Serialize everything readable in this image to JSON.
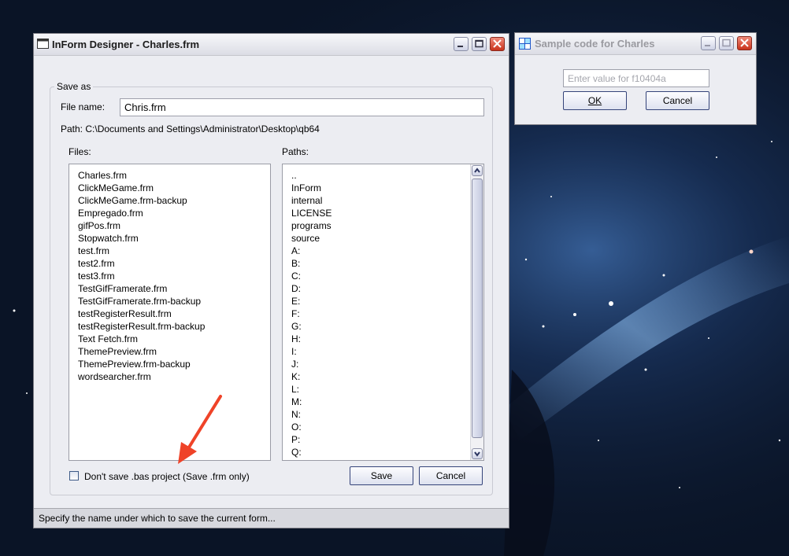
{
  "main_window": {
    "title": "InForm Designer - Charles.frm",
    "save_as": {
      "group_label": "Save as",
      "file_name_label": "File name:",
      "file_name_value": "Chris.frm",
      "path_text": "Path: C:\\Documents and Settings\\Administrator\\Desktop\\qb64",
      "files_label": "Files:",
      "paths_label": "Paths:",
      "files": [
        "Charles.frm",
        "ClickMeGame.frm",
        "ClickMeGame.frm-backup",
        "Empregado.frm",
        "gifPos.frm",
        "Stopwatch.frm",
        "test.frm",
        "test2.frm",
        "test3.frm",
        "TestGifFramerate.frm",
        "TestGifFramerate.frm-backup",
        "testRegisterResult.frm",
        "testRegisterResult.frm-backup",
        "Text Fetch.frm",
        "ThemePreview.frm",
        "ThemePreview.frm-backup",
        "wordsearcher.frm"
      ],
      "paths": [
        "..",
        "InForm",
        "internal",
        "LICENSE",
        "programs",
        "source",
        "A:",
        "B:",
        "C:",
        "D:",
        "E:",
        "F:",
        "G:",
        "H:",
        "I:",
        "J:",
        "K:",
        "L:",
        "M:",
        "N:",
        "O:",
        "P:",
        "Q:"
      ],
      "checkbox_label": "Don't save .bas project (Save .frm only)",
      "checkbox_checked": false,
      "save_button": "Save",
      "cancel_button": "Cancel"
    },
    "status_text": "Specify the name under which to save the current form..."
  },
  "sample_window": {
    "title": "Sample code for Charles",
    "input_placeholder": "Enter value for f10404a",
    "ok_button": "OK",
    "cancel_button": "Cancel"
  },
  "colors": {
    "annotation_arrow": "#ef4328",
    "window_bg": "#ecedf2",
    "close_button": "#c9331c"
  }
}
